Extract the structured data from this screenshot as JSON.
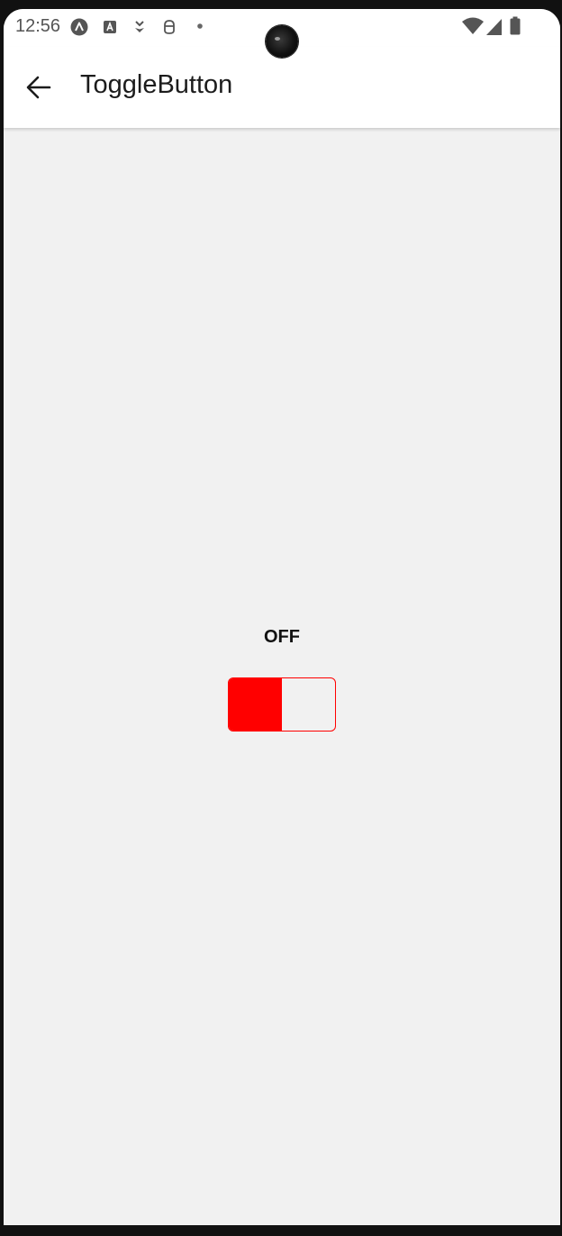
{
  "status_bar": {
    "time": "12:56",
    "left_icons": [
      "a-circle-icon",
      "a-box-icon",
      "download-icon",
      "robot-icon",
      "dot-icon"
    ],
    "right_icons": [
      "wifi-icon",
      "signal-icon",
      "battery-icon"
    ]
  },
  "app_bar": {
    "back_icon": "arrow-left-icon",
    "title": "ToggleButton"
  },
  "toggle": {
    "state_label": "OFF",
    "is_on": false,
    "fill_fraction": 0.5,
    "accent_color": "#ff0000"
  },
  "colors": {
    "background": "#f1f1f1",
    "app_bar": "#ffffff",
    "accent": "#ff0000"
  }
}
